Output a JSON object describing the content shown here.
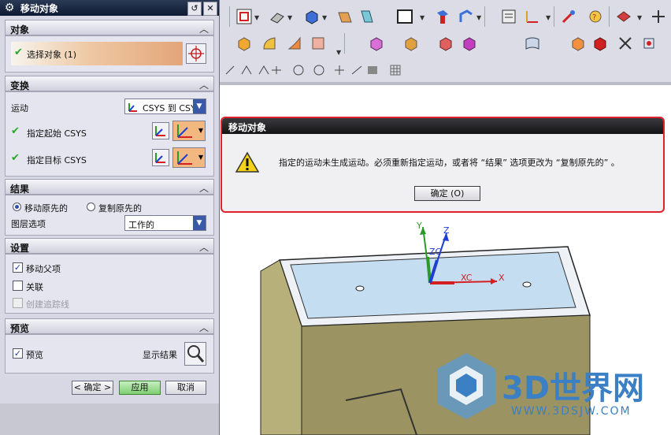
{
  "dialog": {
    "title": "移动对象",
    "sections": {
      "object": "对象",
      "transform": "变换",
      "result": "结果",
      "settings": "设置",
      "preview": "预览"
    },
    "select_object_label": "选择对象 (1)",
    "motion_label": "运动",
    "motion_value": "CSYS 到 CSYS",
    "start_csys_label": "指定起始 CSYS",
    "target_csys_label": "指定目标 CSYS",
    "result_move_label": "移动原先的",
    "result_copy_label": "复制原先的",
    "layer_option_label": "图层选项",
    "layer_option_value": "工作的",
    "move_parent_label": "移动父项",
    "associative_label": "关联",
    "create_trace_label": "创建追踪线",
    "preview_label": "预览",
    "show_result_label": "显示结果",
    "ok_button": "< 确定 >",
    "apply_button": "应用",
    "cancel_button": "取消",
    "move_original_selected": true,
    "move_parent_checked": true,
    "associative_checked": false,
    "create_trace_checked": false,
    "preview_checked": true
  },
  "alert": {
    "title": "移动对象",
    "message": "指定的运动未生成运动。必须重新指定运动，或者将 “结果” 选项更改为 “复制原先的” 。",
    "ok_button": "确定 (O)"
  },
  "axes": {
    "x": "X",
    "y": "Y",
    "z": "Z",
    "xc": "XC",
    "zc": "ZC"
  },
  "watermark": {
    "brand": "3D世界网",
    "url": "WWW.3DSJW.COM"
  },
  "colors": {
    "accent_check": "#2aa52a",
    "alert_border": "#e0202a",
    "apply_green": "#7fcf72",
    "axis_x": "#d42020",
    "axis_y": "#2a9a2a",
    "axis_z": "#1f3fd0",
    "watermark": "#3b7fc4"
  }
}
